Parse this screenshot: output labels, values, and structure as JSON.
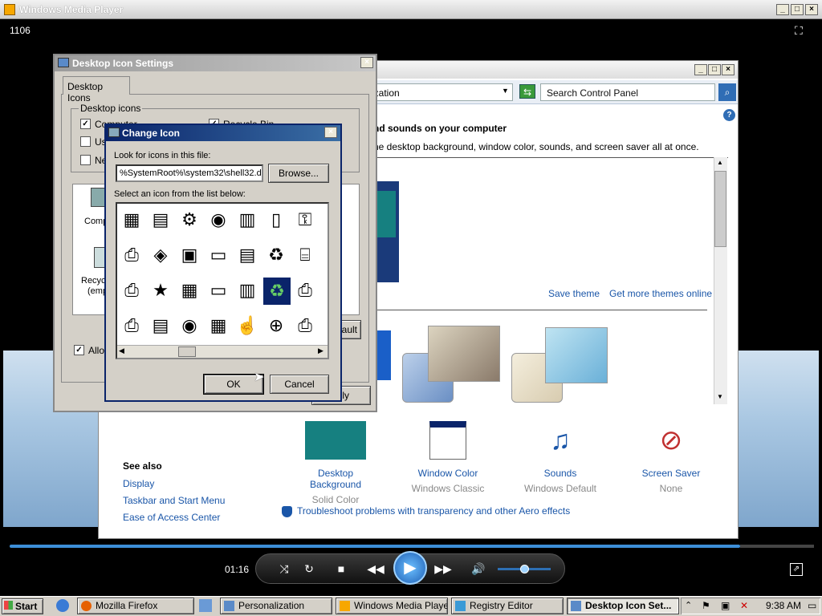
{
  "wmp": {
    "title": "Windows Media Player",
    "counter": "1106",
    "elapsed": "01:16",
    "seek_fraction": 0.895,
    "volume_fraction": 0.5
  },
  "personalization": {
    "address": "ization",
    "search_placeholder": "Search Control Panel",
    "heading": "nd sounds on your computer",
    "subheading": "he desktop background, window color, sounds, and screen saver all at once.",
    "save_theme": "Save theme",
    "get_more_themes": "Get more themes online",
    "settings": [
      {
        "label": "Desktop Background",
        "sub": "Solid Color"
      },
      {
        "label": "Window Color",
        "sub": "Windows Classic"
      },
      {
        "label": "Sounds",
        "sub": "Windows Default"
      },
      {
        "label": "Screen Saver",
        "sub": "None"
      }
    ],
    "see_also_title": "See also",
    "see_also_links": [
      "Display",
      "Taskbar and Start Menu",
      "Ease of Access Center"
    ],
    "troubleshoot": "Troubleshoot problems with transparency and other Aero effects"
  },
  "desktop_icon_settings": {
    "title": "Desktop Icon Settings",
    "tab": "Desktop Icons",
    "group_label": "Desktop icons",
    "chk_computer": "Computer",
    "chk_recycle": "Recycle Bin",
    "chk_user": "Us",
    "chk_network": "Ne",
    "list_computer": "Comp",
    "list_recycle": "Recyc",
    "list_recycle2": "(emp",
    "allow": "Allov",
    "btn_default": "ault",
    "btn_apply": "ply"
  },
  "change_icon": {
    "title": "Change Icon",
    "look_label": "Look for icons in this file:",
    "file_value": "%SystemRoot%\\system32\\shell32.d",
    "browse": "Browse...",
    "select_label": "Select an icon from the list below:",
    "ok": "OK",
    "cancel": "Cancel"
  },
  "taskbar": {
    "start": "Start",
    "tasks": [
      "Mozilla Firefox",
      "Personalization",
      "Windows Media Player",
      "Registry Editor",
      "Desktop Icon Set..."
    ],
    "clock": "9:38 AM"
  },
  "colors": {
    "accent": "#0a246a",
    "link": "#1a56a8",
    "seek": "#3d8fd8"
  }
}
